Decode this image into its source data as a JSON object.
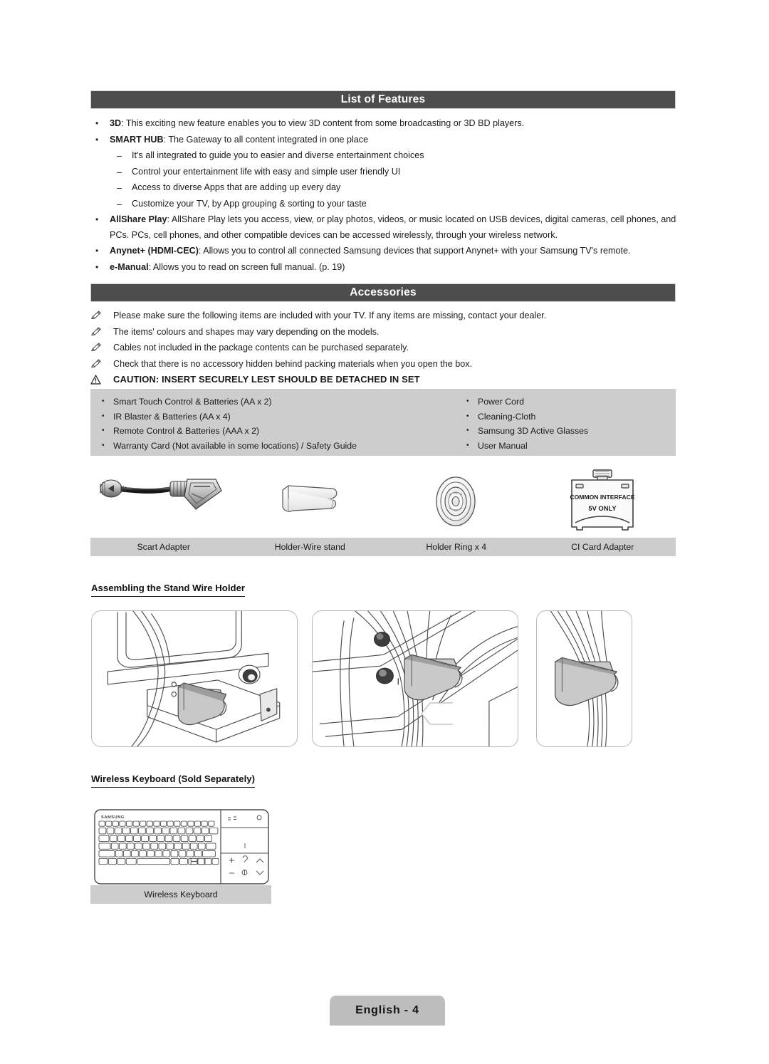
{
  "document": {
    "page_label": "English - 4"
  },
  "sections": {
    "features": {
      "title": "List of Features",
      "items": [
        {
          "level": "bullet",
          "marker": "•",
          "bold": "3D",
          "text": ": This exciting new feature enables you to view 3D content from some broadcasting or 3D BD players."
        },
        {
          "level": "bullet",
          "marker": "•",
          "bold": "SMART HUB",
          "text": ": The Gateway to all content integrated in one place"
        },
        {
          "level": "sub",
          "marker": "–",
          "bold": "",
          "text": "It's all integrated to guide you to easier and diverse entertainment choices"
        },
        {
          "level": "sub",
          "marker": "–",
          "bold": "",
          "text": "Control your entertainment life with easy and simple user friendly UI"
        },
        {
          "level": "sub",
          "marker": "–",
          "bold": "",
          "text": "Access to diverse Apps that are adding up every day"
        },
        {
          "level": "sub",
          "marker": "–",
          "bold": "",
          "text": "Customize your TV, by App grouping & sorting to your taste"
        },
        {
          "level": "bullet",
          "marker": "•",
          "bold": "AllShare Play",
          "text": ": AllShare Play lets you access, view, or play photos, videos, or music located on USB devices, digital cameras, cell phones, and PCs. PCs, cell phones, and other compatible devices can be accessed wirelessly, through your wireless network."
        },
        {
          "level": "bullet",
          "marker": "•",
          "bold": "Anynet+ (HDMI-CEC)",
          "text": ": Allows you to control all connected Samsung devices that support Anynet+ with your Samsung TV's remote."
        },
        {
          "level": "bullet",
          "marker": "•",
          "bold": "e-Manual",
          "text": ": Allows you to read on screen full manual. (p. 19)"
        }
      ]
    },
    "accessories": {
      "title": "Accessories",
      "notes": [
        "Please make sure the following items are included with your TV. If any items are missing, contact your dealer.",
        "The items' colours and shapes may vary depending on the models.",
        "Cables not included in the package contents can be purchased separately.",
        "Check that there is no accessory hidden behind packing materials when you open the box."
      ],
      "caution": "CAUTION: INSERT SECURELY LEST SHOULD BE DETACHED IN SET",
      "items_left": [
        "Smart Touch Control & Batteries (AA x 2)",
        "IR Blaster & Batteries (AA x 4)",
        "Remote Control & Batteries (AAA x 2)",
        "Warranty Card (Not available in some locations) / Safety Guide"
      ],
      "items_right": [
        "Power Cord",
        "Cleaning-Cloth",
        "Samsung 3D Active Glasses",
        "User Manual"
      ],
      "bullet_marker": "•",
      "figures": [
        {
          "icon": "scart-adapter-icon",
          "caption": "Scart Adapter"
        },
        {
          "icon": "holder-wire-stand-icon",
          "caption": "Holder-Wire stand"
        },
        {
          "icon": "holder-ring-icon",
          "caption": "Holder Ring x 4"
        },
        {
          "icon": "ci-card-adapter-icon",
          "caption": "CI Card Adapter"
        }
      ],
      "ci_card_labels": {
        "line1": "COMMON INTERFACE",
        "line2": "5V ONLY"
      }
    },
    "stand_wire_holder": {
      "heading": "Assembling the Stand Wire Holder"
    },
    "wireless_keyboard": {
      "heading": "Wireless Keyboard (Sold Separately)",
      "caption": "Wireless Keyboard",
      "brand": "SAMSUNG"
    }
  },
  "colors": {
    "section_bar": "#4d4d4d",
    "panel_grey": "#cdcdcd",
    "footer_grey": "#bdbdbd",
    "illustration_line": "#4a4a4a",
    "text": "#1a1a1a"
  }
}
